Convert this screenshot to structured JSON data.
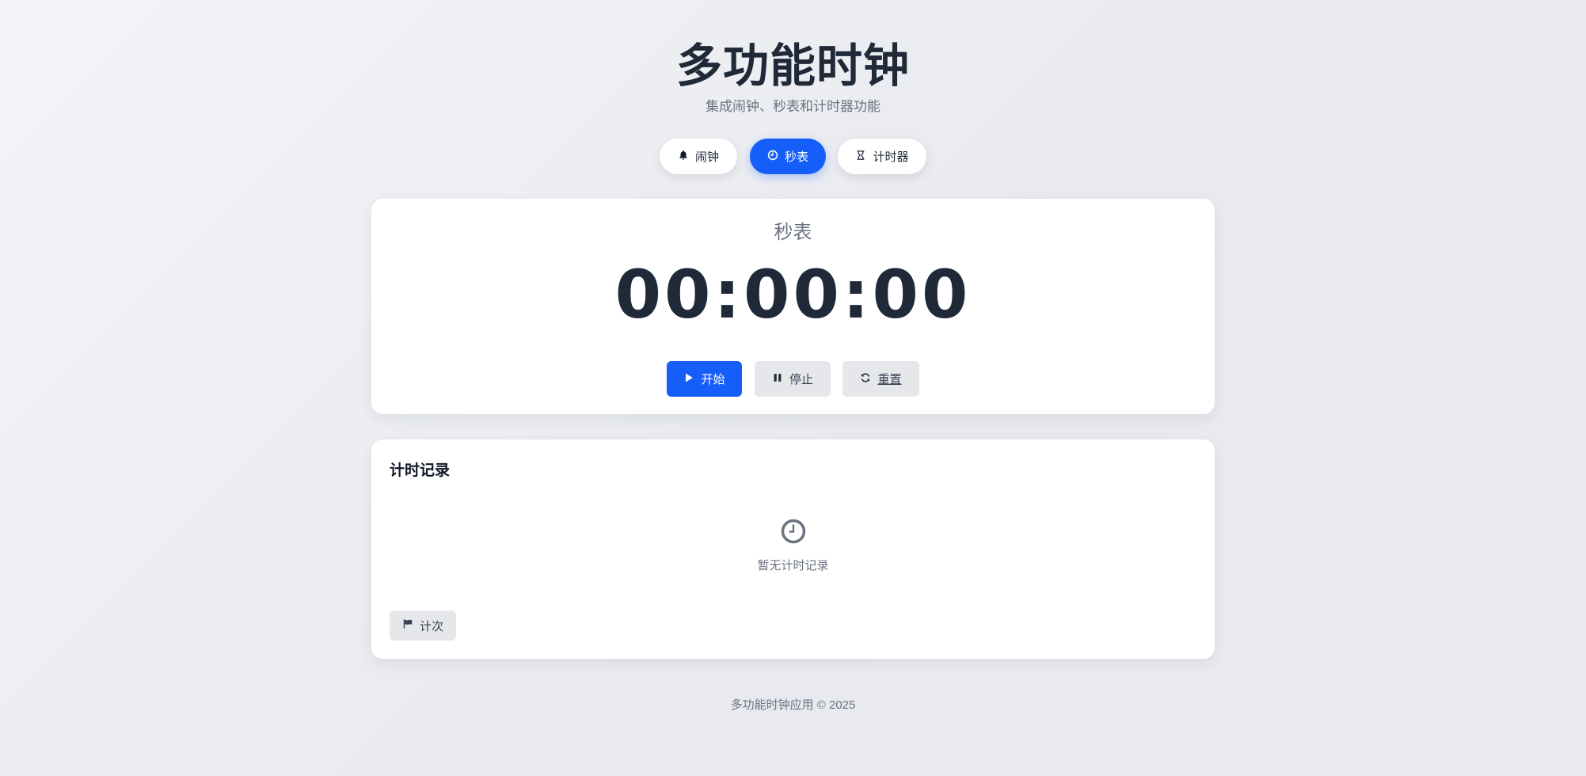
{
  "header": {
    "title": "多功能时钟",
    "subtitle": "集成闹钟、秒表和计时器功能"
  },
  "tabs": [
    {
      "label": "闹钟",
      "icon": "bell-icon",
      "active": false
    },
    {
      "label": "秒表",
      "icon": "clock-icon",
      "active": true
    },
    {
      "label": "计时器",
      "icon": "hourglass-icon",
      "active": false
    }
  ],
  "stopwatch": {
    "mode_title": "秒表",
    "time": "00:00:00",
    "start_label": "开始",
    "stop_label": "停止",
    "reset_label": "重置"
  },
  "records": {
    "title": "计时记录",
    "empty_text": "暂无计时记录",
    "lap_label": "计次"
  },
  "footer": {
    "text": "多功能时钟应用 © 2025"
  },
  "colors": {
    "accent": "#155ef9",
    "text_dark": "#1f2937",
    "text_muted": "#6b7280",
    "button_gray": "#e5e7eb"
  }
}
